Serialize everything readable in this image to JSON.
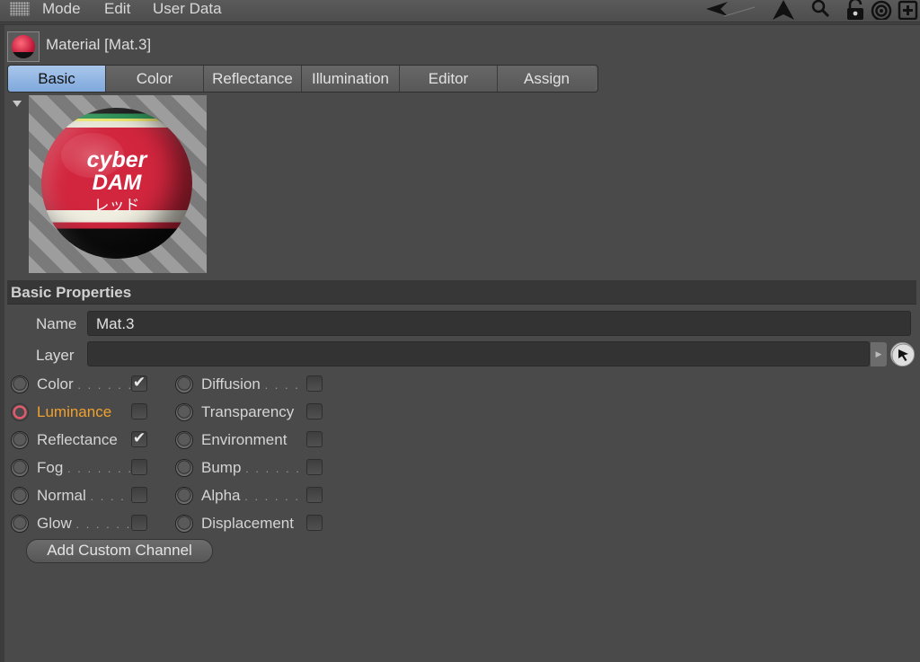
{
  "menubar": {
    "items": [
      "Mode",
      "Edit",
      "User Data"
    ],
    "icons": [
      "arrow-left-icon",
      "arrow-up-icon",
      "search-icon",
      "lock-icon",
      "target-icon",
      "add-window-icon"
    ]
  },
  "header": {
    "title": "Material [Mat.3]"
  },
  "tabs": [
    "Basic",
    "Color",
    "Reflectance",
    "Illumination",
    "Editor",
    "Assign"
  ],
  "active_tab": "Basic",
  "preview": {
    "text_lines": [
      "cyber",
      "DAM",
      "レッド"
    ]
  },
  "section": {
    "title": "Basic Properties",
    "name_label": "Name",
    "name_value": "Mat.3",
    "layer_label": "Layer",
    "layer_value": ""
  },
  "channels": {
    "left": [
      {
        "label": "Color",
        "dots": ". . . . . .",
        "checked": "✔",
        "active": false
      },
      {
        "label": "Luminance",
        "dots": "",
        "checked": "",
        "active": true
      },
      {
        "label": "Reflectance",
        "dots": "",
        "checked": "✔",
        "active": false
      },
      {
        "label": "Fog",
        "dots": ". . . . . . .",
        "checked": "",
        "active": false
      },
      {
        "label": "Normal",
        "dots": ". . . .",
        "checked": "",
        "active": false
      },
      {
        "label": "Glow",
        "dots": ". . . . . .",
        "checked": "",
        "active": false
      }
    ],
    "right": [
      {
        "label": "Diffusion",
        "dots": ". . . .",
        "checked": ""
      },
      {
        "label": "Transparency",
        "dots": "",
        "checked": ""
      },
      {
        "label": "Environment",
        "dots": "",
        "checked": ""
      },
      {
        "label": "Bump",
        "dots": ". . . . . .",
        "checked": ""
      },
      {
        "label": "Alpha",
        "dots": ". . . . . .",
        "checked": ""
      },
      {
        "label": "Displacement",
        "dots": "",
        "checked": ""
      }
    ]
  },
  "add_custom_channel_label": "Add Custom Channel",
  "colors": {
    "background": "#4a4a4a",
    "active_tab": "#8fb3e2",
    "active_channel_text": "#f1a12d",
    "active_radio": "#e25a6b"
  }
}
